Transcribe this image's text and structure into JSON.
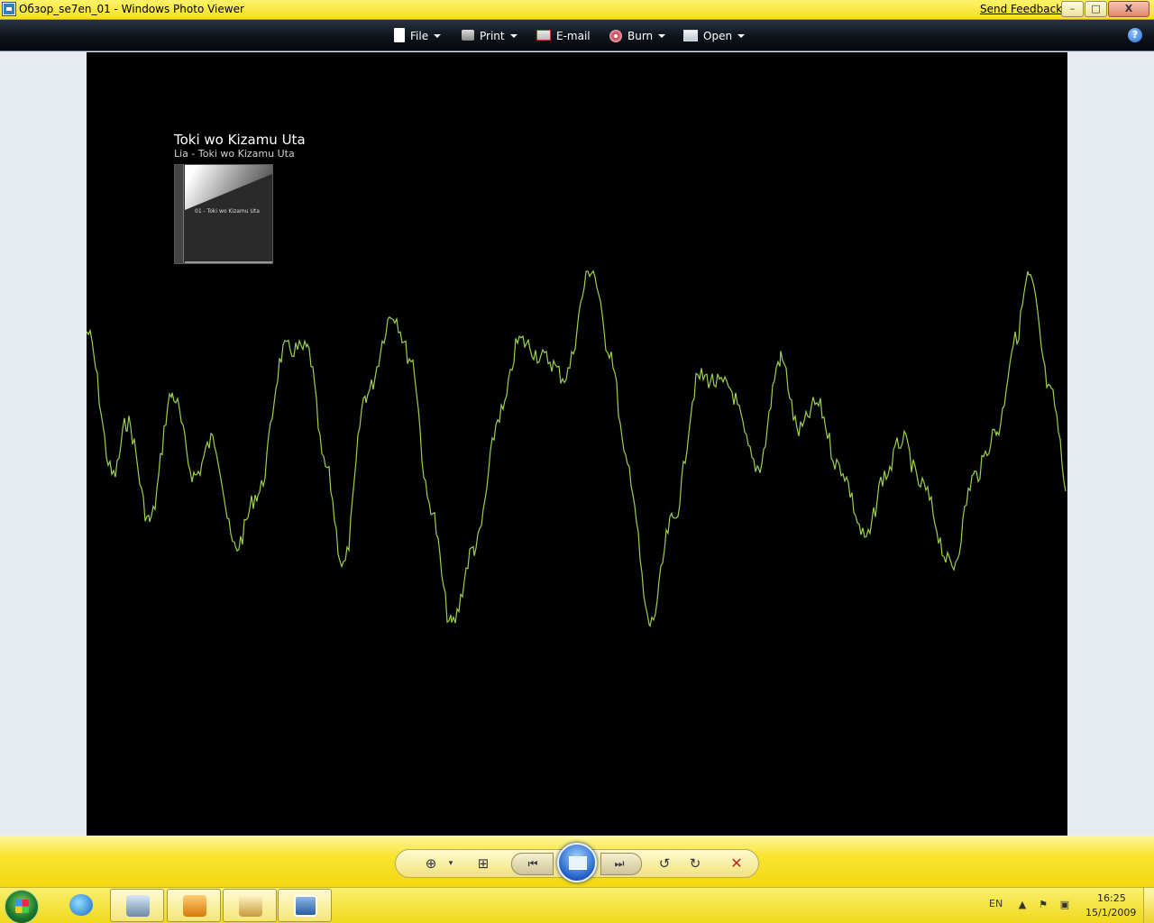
{
  "window": {
    "title": "Обзор_se7en_01 - Windows Photo Viewer",
    "send_feedback": "Send Feedback",
    "minimize": "–",
    "maximize": "□",
    "close": "X"
  },
  "toolbar": {
    "file": "File",
    "print": "Print",
    "email": "E-mail",
    "burn": "Burn",
    "open": "Open",
    "help": "?"
  },
  "photo": {
    "track_title": "Toki wo Kizamu Uta",
    "track_subtitle": "Lia - Toki wo Kizamu Uta",
    "cover_caption": "01 - Toki wo Kizamu Uta",
    "background_color": "#000000",
    "waveform_color": "#9bd14a"
  },
  "controls": {
    "zoom_icon": "magnifier-icon",
    "fit_icon": "actual-size-icon",
    "previous_icon": "previous-icon",
    "slideshow_icon": "slideshow-icon",
    "next_icon": "next-icon",
    "rotate_ccw_icon": "rotate-counterclockwise-icon",
    "rotate_cw_icon": "rotate-clockwise-icon",
    "delete_icon": "delete-icon"
  },
  "taskbar": {
    "language": "EN",
    "time": "16:25",
    "date": "15/1/2009"
  },
  "theme": {
    "accent": "#f6e020",
    "toolbar_bg": "#0e141c"
  }
}
